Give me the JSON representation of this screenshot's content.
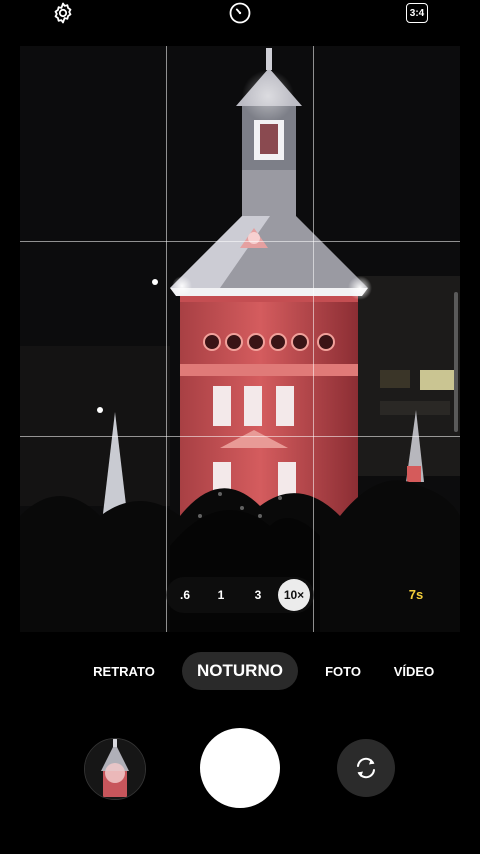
{
  "top_bar": {
    "settings_icon": "gear-icon",
    "timer_icon": "timer-icon",
    "ratio_label": "3:4"
  },
  "zoom": {
    "levels": [
      ".6",
      "1",
      "3",
      "10×"
    ],
    "selected": "10×"
  },
  "exposure_time": "7s",
  "modes": {
    "retrato": "RETRATO",
    "noturno": "NOTURNO",
    "foto": "FOTO",
    "video": "VÍDEO",
    "selected": "NOTURNO"
  },
  "controls": {
    "gallery_icon": "gallery-thumbnail",
    "shutter_icon": "shutter-button",
    "switch_icon": "switch-camera-icon"
  },
  "colors": {
    "accent_exposure": "#f4cf3a",
    "mode_pill_bg": "#2a2a2a"
  }
}
